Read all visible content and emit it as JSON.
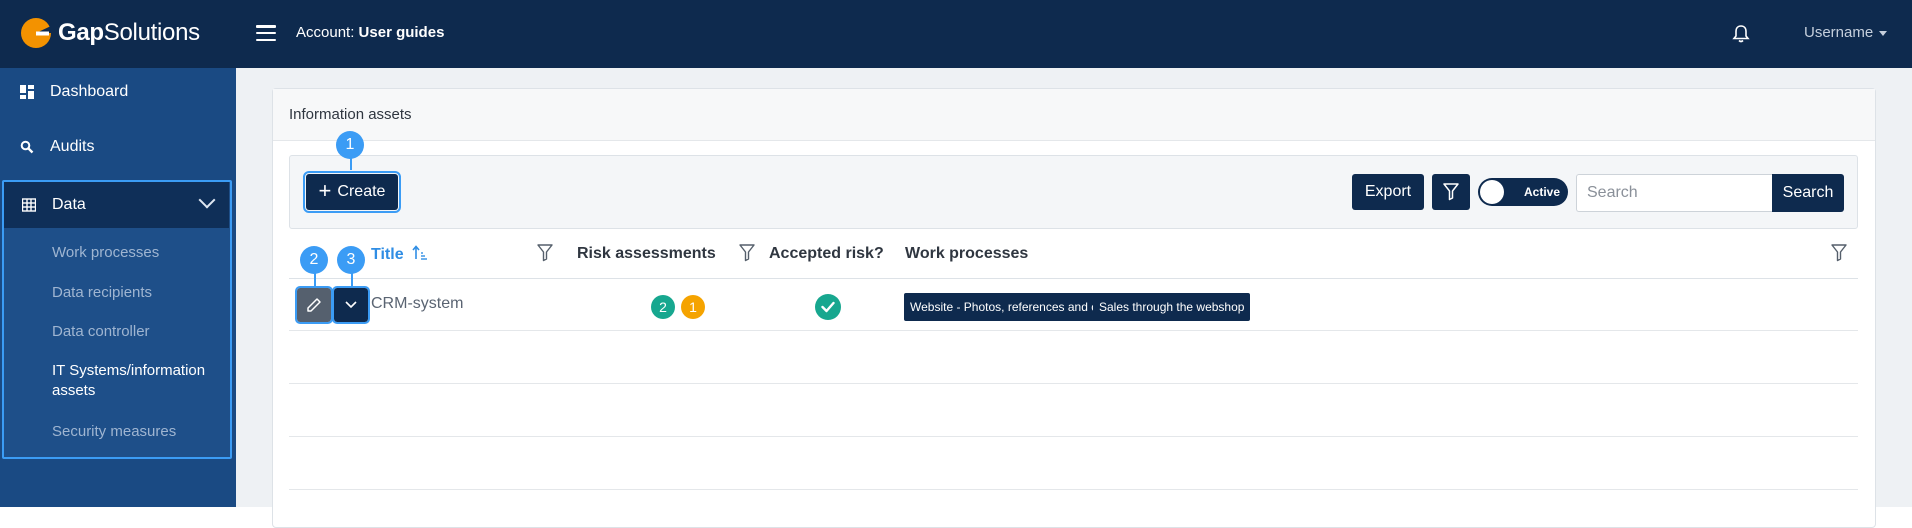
{
  "header": {
    "brand_bold": "Gap",
    "brand_rest": "Solutions",
    "account_label": "Account:",
    "account_name": "User guides",
    "username": "Username"
  },
  "sidebar": {
    "dashboard": "Dashboard",
    "audits": "Audits",
    "data": "Data",
    "sub_items": [
      "Work processes",
      "Data recipients",
      "Data controller",
      "IT Systems/information assets",
      "Security measures"
    ]
  },
  "card": {
    "title": "Information assets"
  },
  "toolbar": {
    "create": "Create",
    "export": "Export",
    "toggle_label": "Active",
    "search_placeholder": "Search",
    "search_button": "Search"
  },
  "table": {
    "headers": {
      "title": "Title",
      "risk": "Risk assessments",
      "accepted": "Accepted risk?",
      "work": "Work processes"
    },
    "rows": [
      {
        "title": "CRM-system",
        "risk_green": "2",
        "risk_orange": "1",
        "accepted": true,
        "work_processes": [
          "Website - Photos, references and cookies",
          "Sales through the webshop"
        ]
      }
    ]
  },
  "callouts": [
    "1",
    "2",
    "3"
  ],
  "colors": {
    "navy": "#0e2a4e",
    "sidebar": "#1a4a83",
    "accent": "#3b9cf5",
    "green": "#17a78f",
    "orange": "#f5a300",
    "logo_orange": "#f39200"
  }
}
